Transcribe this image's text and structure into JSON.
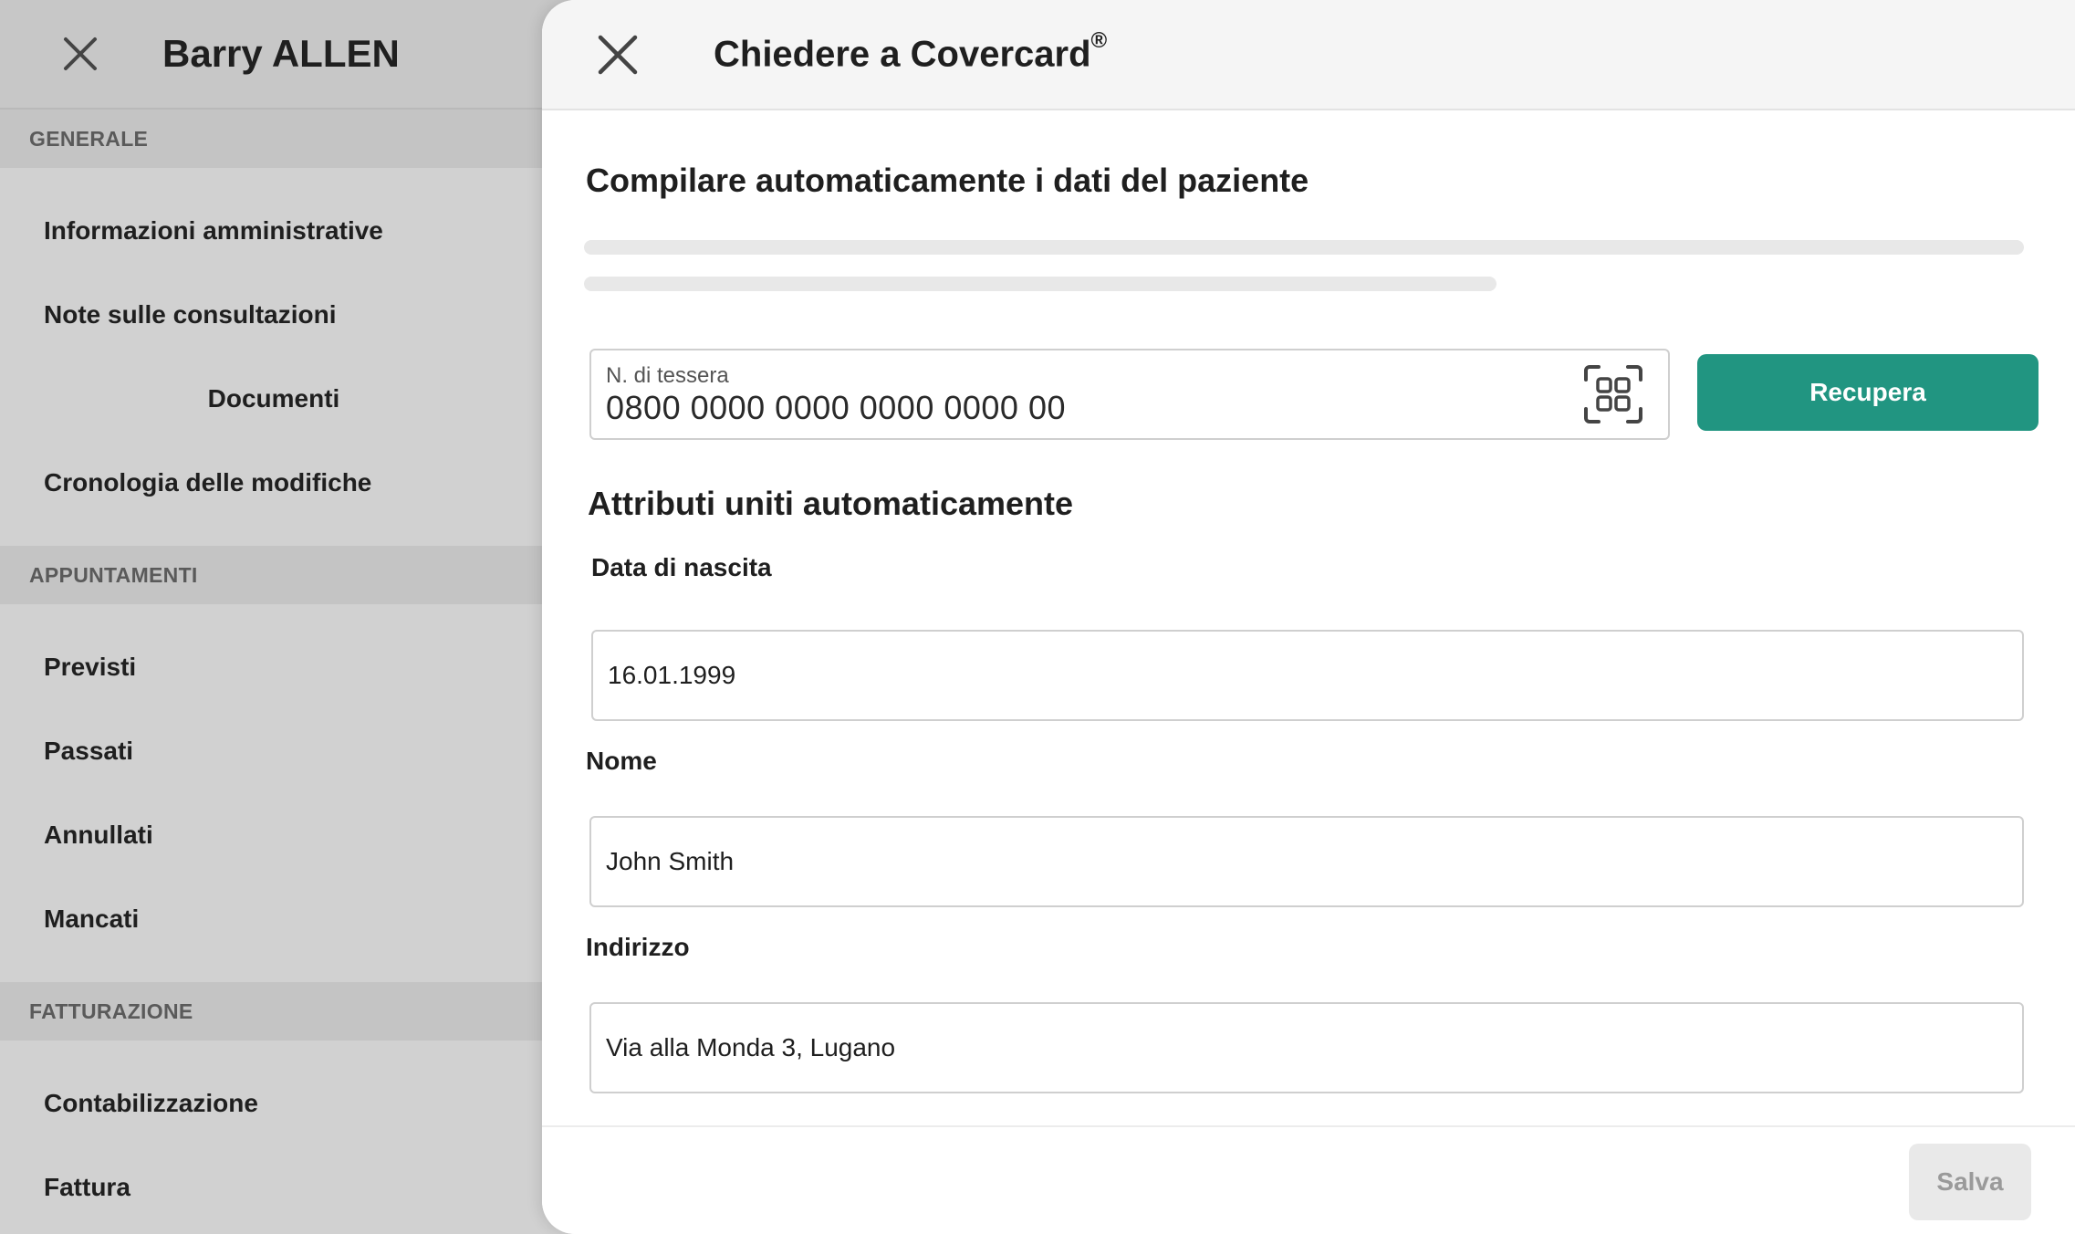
{
  "sidebar": {
    "title": "Barry ALLEN",
    "sections": [
      {
        "label": "GENERALE",
        "items": [
          "Informazioni amministrative",
          "Note sulle consultazioni",
          "Documenti",
          "Cronologia delle modifiche"
        ]
      },
      {
        "label": "APPUNTAMENTI",
        "items": [
          "Previsti",
          "Passati",
          "Annullati",
          "Mancati"
        ]
      },
      {
        "label": "FATTURAZIONE",
        "items": [
          "Contabilizzazione",
          "Fattura"
        ]
      }
    ]
  },
  "modal": {
    "title": "Chiedere a Covercard",
    "title_mark": "®",
    "heading": "Compilare automaticamente i dati del paziente",
    "card_field": {
      "label": "N. di tessera",
      "value": "0800 0000 0000 0000 0000 00"
    },
    "fetch_button": "Recupera",
    "merged_heading": "Attributi uniti automaticamente",
    "fields": [
      {
        "label": "Data di nascita",
        "value": "16.01.1999"
      },
      {
        "label": "Nome",
        "value": "John Smith"
      },
      {
        "label": "Indirizzo",
        "value": "Via alla Monda 3, Lugano"
      }
    ],
    "save_button": "Salva"
  },
  "colors": {
    "primary": "#219581",
    "sidebar_bg": "#d1d1d1",
    "section_bg": "#c4c4c4",
    "disabled_bg": "#e9e9e9"
  },
  "icons": {
    "sidebar_close": "close-icon",
    "modal_close": "close-icon",
    "card_scan": "scan-icon"
  }
}
